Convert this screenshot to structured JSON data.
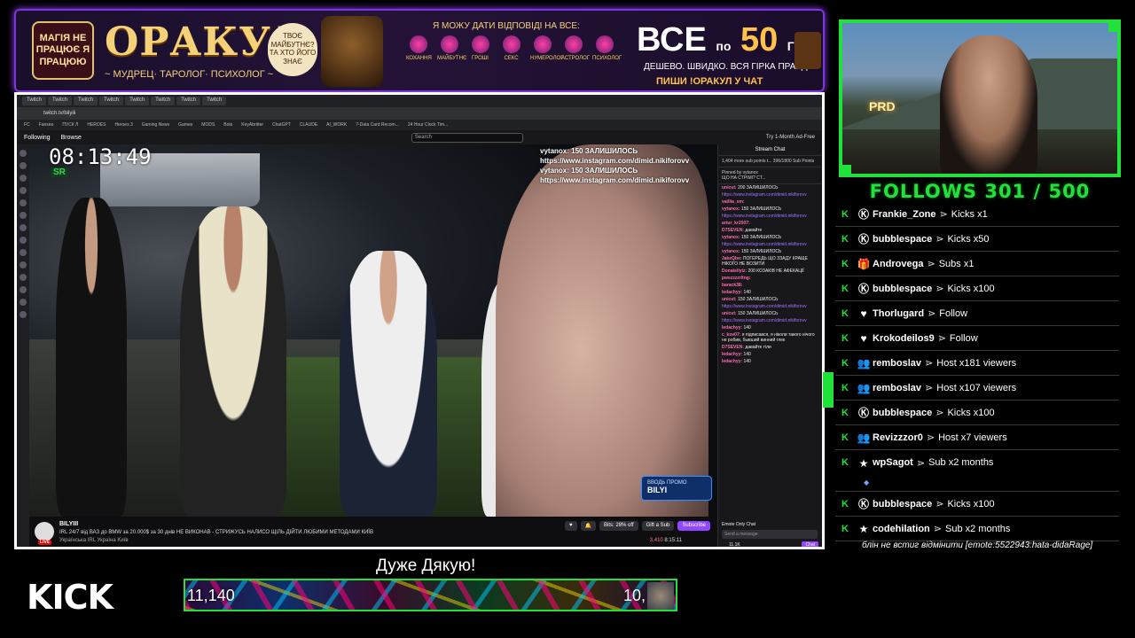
{
  "banner": {
    "tag": "МАГІЯ НЕ ПРАЦЮЄ Я ПРАЦЮЮ",
    "title": "ОРАКУЛ",
    "subtitle": "~ МУДРЕЦ· ТАРОЛОГ· ПСИХОЛОГ ~",
    "bubble": "ТВОЄ МАЙБУТНЄ? ТА ХТО ЙОГО ЗНАЄ",
    "question": "Я МОЖУ ДАТИ ВІДПОВІДІ НА ВСЕ:",
    "icons": [
      {
        "label": "КОХАННЯ",
        "icon": "heart-icon"
      },
      {
        "label": "МАЙБУТНЄ",
        "icon": "crystal-ball-icon"
      },
      {
        "label": "ГРОШІ",
        "icon": "money-icon"
      },
      {
        "label": "СЕКС",
        "icon": "peach-icon"
      },
      {
        "label": "НУМЕРОЛОГ",
        "icon": "numbers-icon"
      },
      {
        "label": "АСТРОЛОГ",
        "icon": "moon-icon"
      },
      {
        "label": "ПСИХОЛОГ",
        "icon": "brain-icon"
      }
    ],
    "price_prefix": "ВСЕ",
    "price_word": "по",
    "price_value": "50",
    "price_currency": "ГРН.",
    "tagline": "ДЕШЕВО. ШВИДКО. ВСЯ ГІРКА ПРАВДА.",
    "cta": "ПИШИ !ОРАКУЛ У ЧАТ"
  },
  "browser": {
    "tabs": [
      "Twitch",
      "Twitch",
      "Twitch",
      "Twitch",
      "Twitch",
      "Twitch",
      "Twitch",
      "Twitch"
    ],
    "url": "twitch.tv/bilyiii",
    "bookmarks": [
      "FC",
      "Fansee",
      "ПУСК Л",
      "HEROES",
      "Heroes 3",
      "Gaming News",
      "Games",
      "MODS",
      "Bots",
      "KeyAbritter",
      "ChatGPT",
      "CLAUDE",
      "AI_WORK",
      "7-Data Card Recom...",
      "24 Hour Clock Tim..."
    ]
  },
  "twitch": {
    "nav_following": "Following",
    "nav_browse": "Browse",
    "search_placeholder": "Search",
    "ad_free": "Try 1-Month Ad-Free"
  },
  "video": {
    "clock": "08:13:49",
    "clock_tag": "SR",
    "overlay_messages": [
      {
        "user": "vytanox:",
        "text": "150 ЗАЛИШИЛОСЬ"
      },
      {
        "user": "",
        "text": "https://www.instagram.com/dimid.nikiforovv"
      },
      {
        "user": "vytanox:",
        "text": "150 ЗАЛИШИЛОСЬ"
      },
      {
        "user": "",
        "text": "https://www.instagram.com/dimid.nikiforovv"
      }
    ],
    "promo_label": "ВВОДЬ ПРОМО",
    "promo_code": "BILYI"
  },
  "stream_info": {
    "channel": "BILYIII",
    "title": "IRL 24/7 від ВАЗ до BMW за 20.000$ за 30 днів НЕ ВИКОНАВ - СТРИЖУСЬ НАЛИСО ЩІЛЬ ДІЙТИ ЛЮБИМИ МЕТОДАМИ КИЇВ",
    "tags": [
      "Українська",
      "IRL",
      "Україна",
      "Kиїв"
    ],
    "live": "LIVE",
    "bits": "Bits: 28% off",
    "gift": "Gift a Sub",
    "subscribe": "Subscribe",
    "viewers": "3,410",
    "uptime": "8:15:11"
  },
  "stream_chat": {
    "header": "Stream Chat",
    "goal": "1,404 more sub points t... 396/1800 Sub Points",
    "pinned": "Pinned by vytanox",
    "pinned_text": "ЩО НА СТРІМІ? СТ...",
    "lines": [
      {
        "user": "unicut:",
        "text": "200 ЗАЛИШИЛОСЬ"
      },
      {
        "user": "",
        "text": "https://www.instagram.com/dimid.nikiforovv"
      },
      {
        "user": "vaillia_sm:",
        "text": ""
      },
      {
        "user": "vytanox:",
        "text": "150 ЗАЛИШИЛОСЬ"
      },
      {
        "user": "",
        "text": "https://www.instagram.com/dimid.nikiforovv"
      },
      {
        "user": "artur_kr2007:",
        "text": ""
      },
      {
        "user": "D7SEVEN:",
        "text": "давайте"
      },
      {
        "user": "vytanox:",
        "text": "150 ЗАЛИШИЛОСЬ"
      },
      {
        "user": "",
        "text": "https://www.instagram.com/dimid.nikiforovv"
      },
      {
        "user": "vytanox:",
        "text": "150 ЗАЛИШИЛОСЬ"
      },
      {
        "user": "JakeQbe:",
        "text": "ПОГЕРЕДЬ ЩО ЗЗАДУ КРАЩЕ НІКОГО НЕ ВОЗИТИ"
      },
      {
        "user": "Donatellylz:",
        "text": "200 КОЗАКІВ НЕ АФЕКАЦІЇ"
      },
      {
        "user": "pwezzzzrltng:",
        "text": ""
      },
      {
        "user": "barack38:",
        "text": ""
      },
      {
        "user": "ledachyy:",
        "text": "140"
      },
      {
        "user": "unicut:",
        "text": "150 ЗАЛИШИЛОСЬ"
      },
      {
        "user": "",
        "text": "https://www.instagram.com/dimid.nikiforovv"
      },
      {
        "user": "unicut:",
        "text": "150 ЗАЛИШИЛОСЬ"
      },
      {
        "user": "",
        "text": "https://www.instagram.com/dimid.nikiforovv"
      },
      {
        "user": "ledachyy:",
        "text": "140"
      },
      {
        "user": "c_kov07:",
        "text": "я підписався, я ніколи такого нічого не робив, бывший винний глек"
      },
      {
        "user": "D7SEVEN:",
        "text": "давайте тіли"
      },
      {
        "user": "ledachyy:",
        "text": "140"
      },
      {
        "user": "ledachyy:",
        "text": "140"
      }
    ],
    "emote_only": "Emote Only Chat",
    "send_placeholder": "Send a message",
    "points": "11.1K",
    "chat_button": "Chat"
  },
  "follows": {
    "label": "FOLLOWS 301 / 500"
  },
  "events": [
    {
      "user": "Frankie_Zone",
      "text": "Kicks x1",
      "icon": "kick-coin-icon"
    },
    {
      "user": "bubblespace",
      "text": "Kicks x50",
      "icon": "kick-coin-icon"
    },
    {
      "user": "Androvega",
      "text": "Subs x1",
      "icon": "gift-icon"
    },
    {
      "user": "bubblespace",
      "text": "Kicks x100",
      "icon": "kick-coin-icon"
    },
    {
      "user": "Thorlugard",
      "text": "Follow",
      "icon": "heart-icon"
    },
    {
      "user": "Krokodeilos9",
      "text": "Follow",
      "icon": "heart-icon"
    },
    {
      "user": "remboslav",
      "text": "Host x181 viewers",
      "icon": "users-icon"
    },
    {
      "user": "remboslav",
      "text": "Host x107 viewers",
      "icon": "users-icon"
    },
    {
      "user": "bubblespace",
      "text": "Kicks x100",
      "icon": "kick-coin-icon"
    },
    {
      "user": "Revizzzor0",
      "text": "Host x7 viewers",
      "icon": "users-icon"
    },
    {
      "user": "wpSagot",
      "text": "Sub x2 months",
      "icon": "star-icon"
    },
    {
      "user": "bubblespace",
      "text": "Kicks x100",
      "icon": "kick-coin-icon"
    },
    {
      "user": "codehilation",
      "text": "Sub x2 months",
      "icon": "star-icon"
    }
  ],
  "event_note": "блін не встиг відмінити [emote:5522943:hata-didaRage]",
  "bottom": {
    "thanks": "Дуже Дякую!",
    "kick_logo": "KICK",
    "goal_left": "11,140",
    "goal_right": "10,"
  }
}
